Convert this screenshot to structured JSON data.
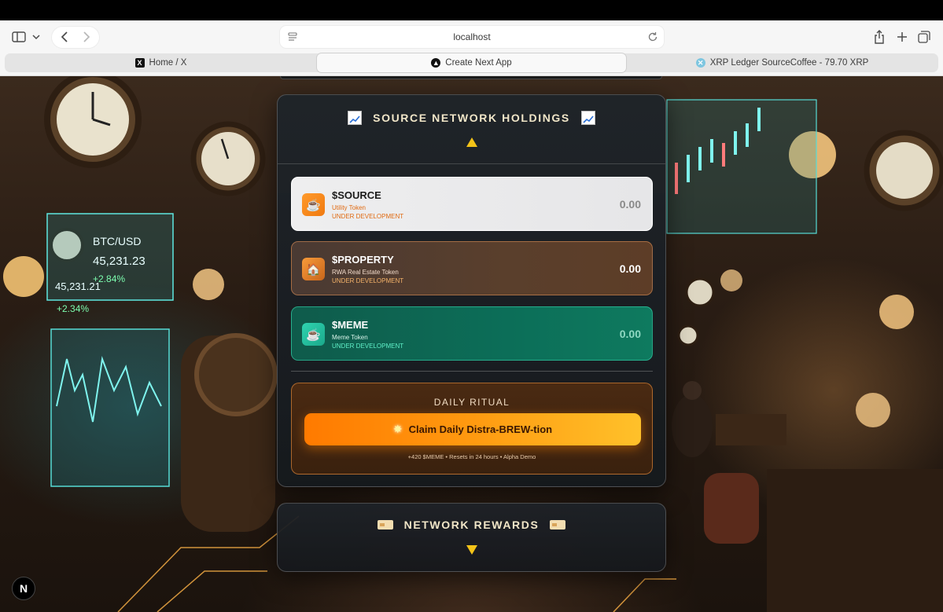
{
  "browser": {
    "address": "localhost",
    "tabs": [
      {
        "label": "Home / X",
        "icon": "x-logo-icon"
      },
      {
        "label": "Create Next App",
        "icon": "nextjs-icon"
      },
      {
        "label": "XRP Ledger SourceCoffee - 79.70 XRP",
        "icon": "xrp-icon"
      }
    ],
    "active_tab": 1
  },
  "holdings": {
    "title": "SOURCE NETWORK HOLDINGS",
    "tokens": [
      {
        "name": "$SOURCE",
        "subtitle": "Utility Token",
        "status": "UNDER DEVELOPMENT",
        "value": "0.00",
        "icon": "coffee-icon"
      },
      {
        "name": "$PROPERTY",
        "subtitle": "RWA Real Estate Token",
        "status": "UNDER DEVELOPMENT",
        "value": "0.00",
        "icon": "house-icon"
      },
      {
        "name": "$MEME",
        "subtitle": "Meme Token",
        "status": "UNDER DEVELOPMENT",
        "value": "0.00",
        "icon": "coffee-icon"
      }
    ]
  },
  "ritual": {
    "title": "DAILY RITUAL",
    "button": "Claim Daily Distra-BREW-tion",
    "note": "+420 $MEME • Resets in 24 hours • Alpha Demo"
  },
  "rewards": {
    "title": "NETWORK REWARDS"
  },
  "dev_badge": "N",
  "colors": {
    "accent_gold": "#f3c318",
    "claim_orange": "#ff8a00",
    "meme_green": "#0c6e58",
    "property_brown": "#5a3f2c"
  }
}
